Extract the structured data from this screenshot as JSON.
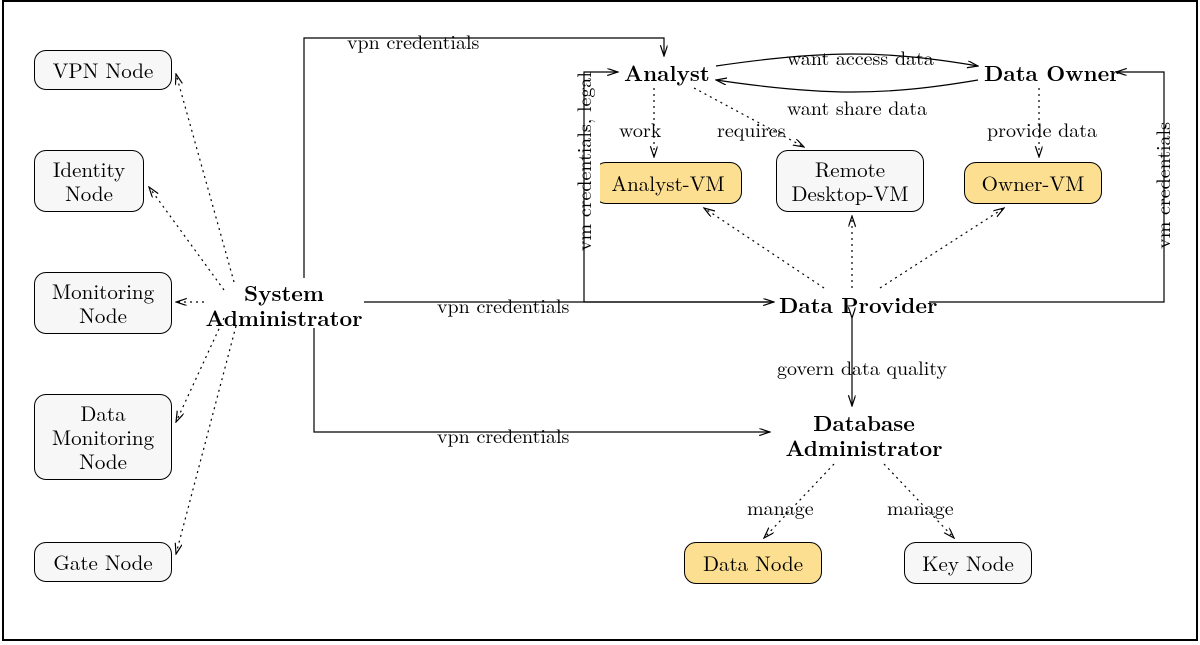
{
  "nodes": {
    "vpn": "VPN Node",
    "identity": "Identity\nNode",
    "monitoring": "Monitoring\nNode",
    "datamon": "Data\nMonitoring\nNode",
    "gate": "Gate Node",
    "analystvm": "Analyst-VM",
    "remotevm": "Remote\nDesktop-VM",
    "ownervm": "Owner-VM",
    "datanode": "Data Node",
    "keynode": "Key Node"
  },
  "actors": {
    "sysadmin": "System\nAdministrator",
    "analyst": "Analyst",
    "dataowner": "Data Owner",
    "dataprov": "Data Provider",
    "dbadmin": "Database\nAdministrator"
  },
  "labels": {
    "vpn1": "vpn credentials",
    "vpn2": "vpn credentials",
    "vpn3": "vpn credentials",
    "vmcred_legal": "vm credentials, legal",
    "vmcred_owner": "vm credentials",
    "want_access": "want access data",
    "want_share": "want share data",
    "work": "work",
    "requires": "requires",
    "provide": "provide data",
    "govern": "govern data quality",
    "manage1": "manage",
    "manage2": "manage"
  }
}
